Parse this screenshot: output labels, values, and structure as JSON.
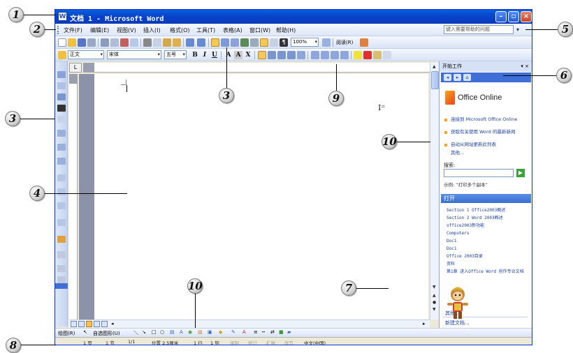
{
  "window": {
    "title": "文档 1 - Microsoft Word",
    "icon_label": "W"
  },
  "menubar": {
    "items": [
      "文件(F)",
      "编辑(E)",
      "视图(V)",
      "插入(I)",
      "格式(O)",
      "工具(T)",
      "表格(A)",
      "窗口(W)",
      "帮助(H)"
    ],
    "ask_placeholder": "键入需要帮助的问题"
  },
  "toolbar_standard": {
    "zoom": "100%",
    "read_label": "阅读(R)"
  },
  "toolbar_format": {
    "style": "正文",
    "font": "宋体",
    "size": "五号"
  },
  "taskpane": {
    "title": "开始工作",
    "logo_text": "Office Online",
    "links": [
      "连接到 Microsoft Office Online",
      "获取有关使用 Word 的最新新闻",
      "自动从网站更新此列表",
      "其他..."
    ],
    "search_label": "搜索:",
    "example": "示例: “打印多个副本”",
    "open_header": "打开",
    "files": [
      "Section 1 Office2003概述",
      "Section 2 Word 2003概述",
      "office2003新功能",
      "Computers",
      "Doc1",
      "Doc1",
      "Office 2003目录",
      "资料",
      "第1章 进入Office Word 创作专业文档"
    ],
    "more": "其他...",
    "new_doc": "新建文档..."
  },
  "drawbar": {
    "draw_label": "绘图(R)",
    "autoshape_label": "自选图形(U)"
  },
  "statusbar": {
    "page": "1 页",
    "section": "1 节",
    "pages": "1/1",
    "position": "位置 2.5厘米",
    "line": "1 行",
    "column": "1 列",
    "modes": [
      "录制",
      "修订",
      "扩展",
      "改写"
    ],
    "language": "中文(中国)"
  },
  "callouts": [
    "1",
    "2",
    "3",
    "3",
    "4",
    "5",
    "6",
    "7",
    "8",
    "9",
    "10",
    "10"
  ],
  "colors": {
    "title_blue": "#0842c9",
    "task_header": "#3f6fd6",
    "toolbar_light": "#f5f8fe",
    "toolbar_dark": "#d8e3f7"
  }
}
